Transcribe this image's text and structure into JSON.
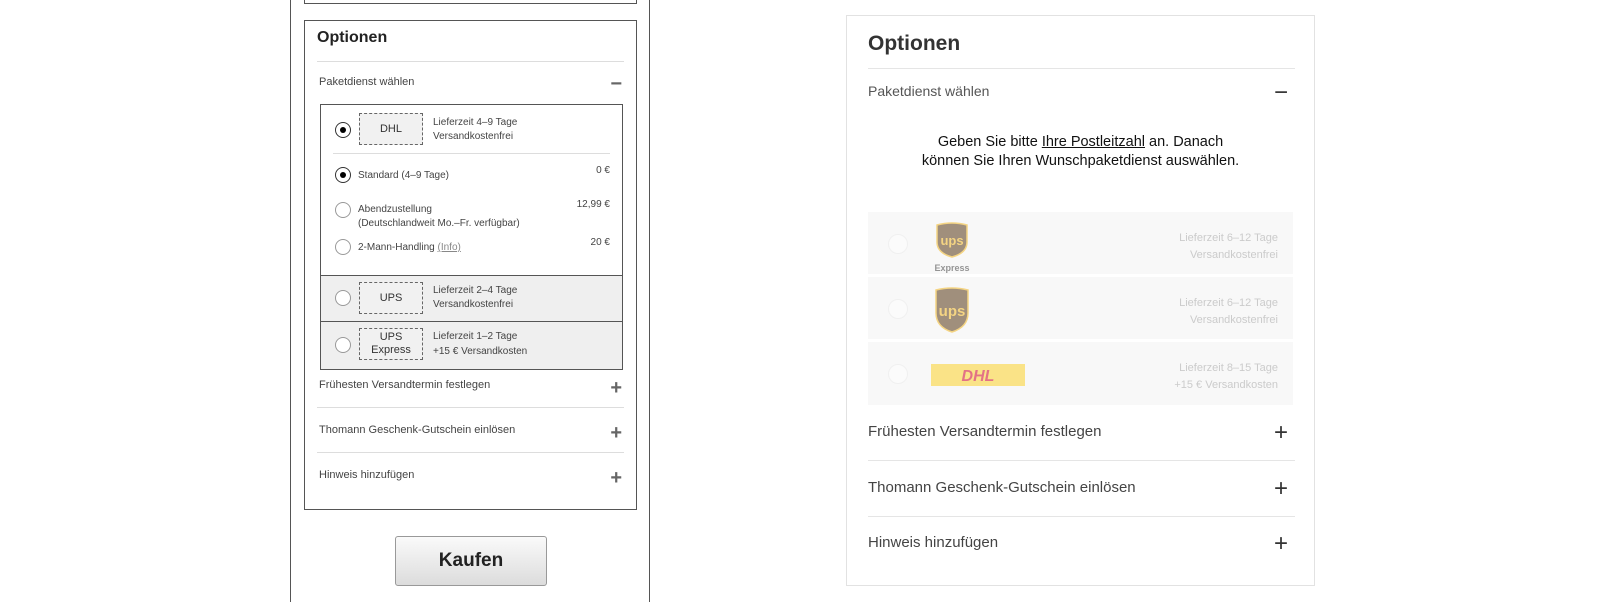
{
  "wireframe": {
    "title": "Optionen",
    "paketdienst_label": "Paketdienst wählen",
    "collapse_sign": "−",
    "expand_sign": "+",
    "carriers": [
      {
        "logo": "DHL",
        "line1": "Lieferzeit 4–9 Tage",
        "line2": "Versandkostenfrei",
        "selected": true
      },
      {
        "logo": "UPS",
        "line1": "Lieferzeit 2–4 Tage",
        "line2": "Versandkostenfrei",
        "selected": false
      },
      {
        "logo": "UPS Express",
        "line1": "Lieferzeit 1–2 Tage",
        "line2": "+15 € Versandkosten",
        "selected": false
      }
    ],
    "sub_options": [
      {
        "label": "Standard (4–9 Tage)",
        "price": "0 €",
        "selected": true
      },
      {
        "label": "Abendzustellung",
        "label2": "(Deutschlandweit Mo.–Fr. verfügbar)",
        "price": "12,99 €",
        "selected": false
      },
      {
        "label": "2-Mann-Handling",
        "info_link": "(Info)",
        "price": "20 €",
        "selected": false
      }
    ],
    "accordions": [
      "Frühesten Versandtermin festlegen",
      "Thomann Geschenk-Gutschein einlösen",
      "Hinweis hinzufügen"
    ],
    "buy_button": "Kaufen"
  },
  "design": {
    "title": "Optionen",
    "paketdienst_label": "Paketdienst wählen",
    "collapse_sign": "−",
    "expand_sign": "+",
    "message_pre": "Geben Sie bitte ",
    "message_link": "Ihre Postleitzahl",
    "message_post": " an. Danach",
    "message_line2": "können Sie Ihren Wunschpaketdienst auswählen.",
    "carriers": [
      {
        "logo_icon": "ups-express-logo",
        "logo_text": "ups",
        "logo_sub": "Express",
        "line1": "Lieferzeit 6–12 Tage",
        "line2": "Versandkostenfrei"
      },
      {
        "logo_icon": "ups-logo",
        "logo_text": "ups",
        "line1": "Lieferzeit 6–12 Tage",
        "line2": "Versandkostenfrei"
      },
      {
        "logo_icon": "dhl-logo",
        "logo_text": "DHL",
        "line1": "Lieferzeit 8–15 Tage",
        "line2": "+15 € Versandkosten"
      }
    ],
    "accordions": [
      "Frühesten Versandtermin festlegen",
      "Thomann Geschenk-Gutschein einlösen",
      "Hinweis hinzufügen"
    ]
  },
  "colors": {
    "ups_brown": "#5a3a17",
    "ups_gold": "#f2b824",
    "dhl_yellow": "#fdd22c",
    "dhl_red": "#d2062a"
  }
}
